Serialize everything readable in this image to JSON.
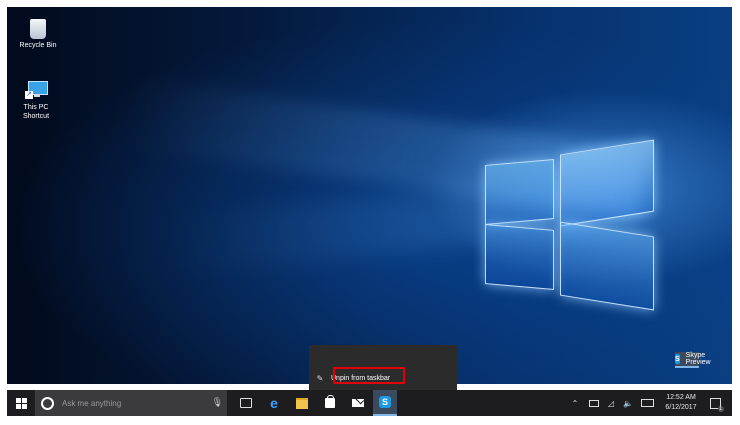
{
  "desktop": {
    "icons": [
      {
        "label": "Recycle Bin"
      },
      {
        "label": "This PC\nShortcut"
      }
    ]
  },
  "jumplist": {
    "items": [
      {
        "label": "Skype Preview",
        "icon": "skype-icon"
      },
      {
        "label": "Unpin from taskbar",
        "icon": "unpin-icon"
      }
    ],
    "highlight_color": "#e0000a"
  },
  "taskbar": {
    "search_placeholder": "Ask me anything",
    "apps": [
      "task-view",
      "edge",
      "file-explorer",
      "store",
      "mail",
      "skype"
    ],
    "clock": {
      "time": "12:52 AM",
      "date": "6/12/2017"
    },
    "notification_count": "1"
  }
}
